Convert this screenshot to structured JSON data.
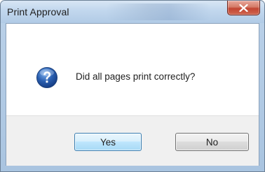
{
  "window": {
    "title": "Print Approval"
  },
  "dialog": {
    "icon": "question-icon",
    "message": "Did all pages print correctly?"
  },
  "buttons": {
    "yes_label": "Yes",
    "no_label": "No"
  },
  "colors": {
    "titlebar": "#c3d8ee",
    "close_button": "#c24532",
    "default_button_border": "#3c7fb1",
    "footer": "#f0f0f0",
    "icon_blue": "#2a5fb0"
  }
}
